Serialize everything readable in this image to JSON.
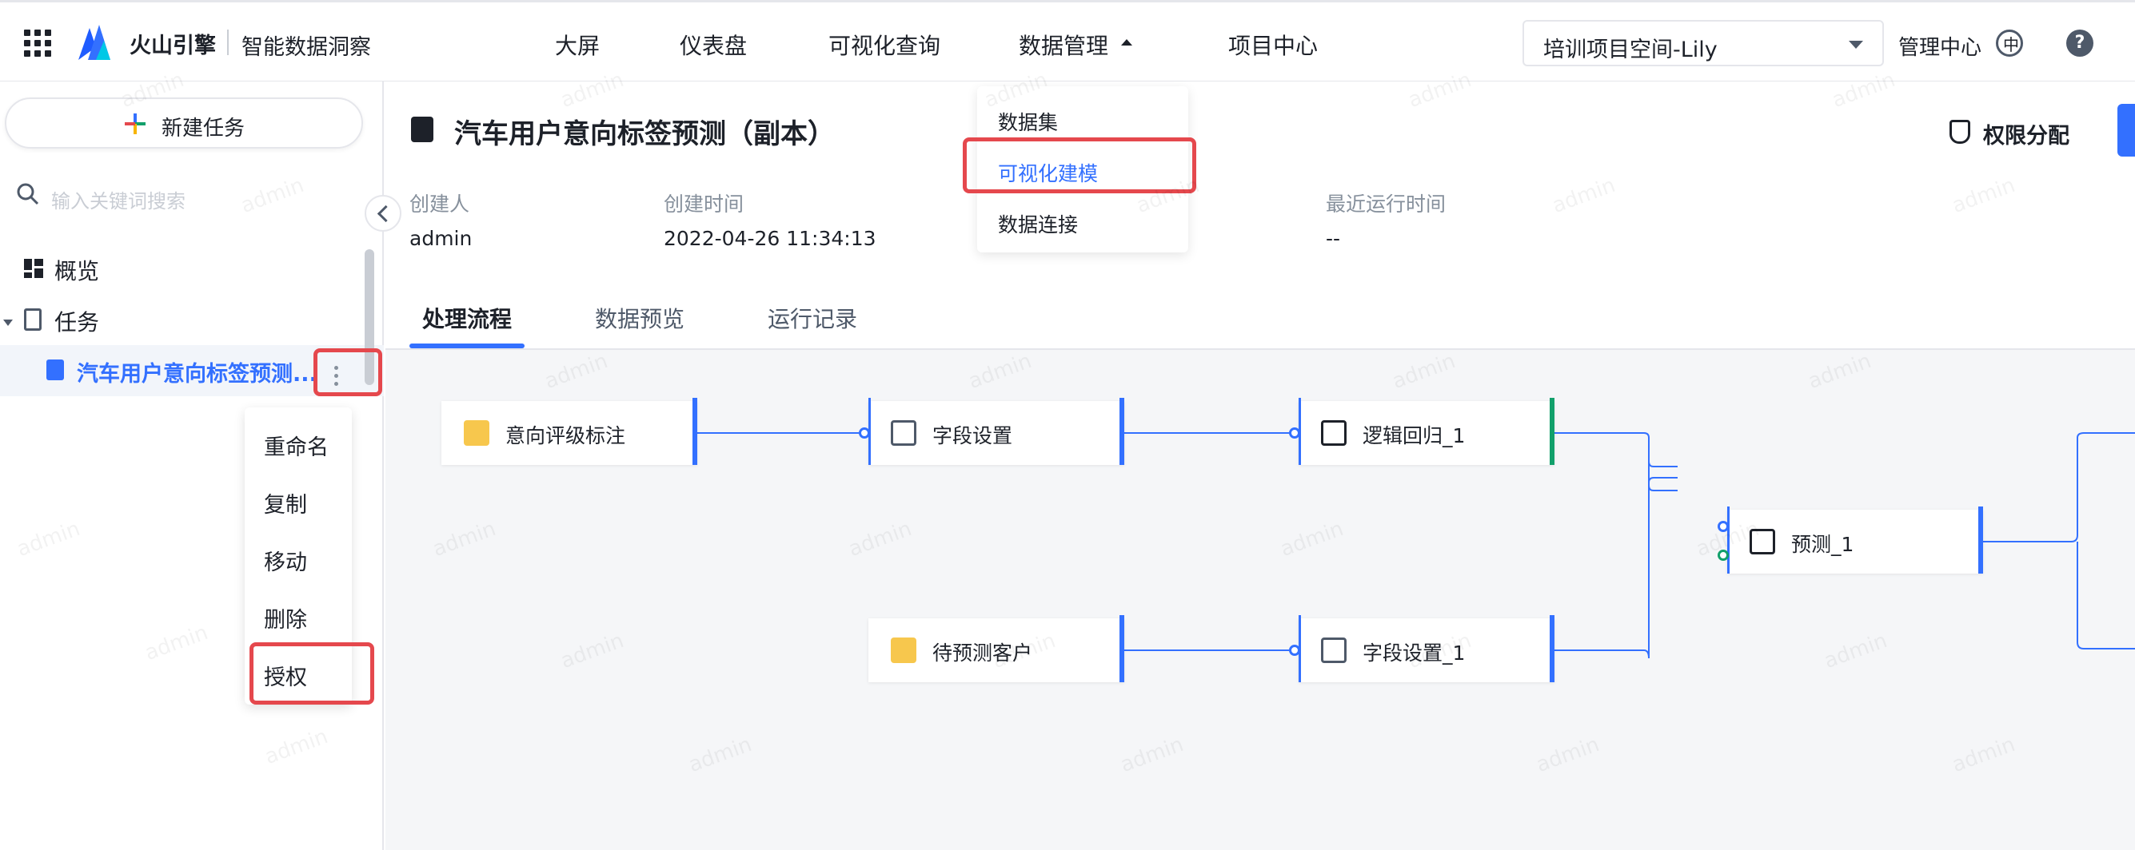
{
  "topbar": {
    "brand": "火山引擎",
    "product": "智能数据洞察",
    "nav": [
      {
        "label": "大屏"
      },
      {
        "label": "仪表盘"
      },
      {
        "label": "可视化查询"
      },
      {
        "label": "数据管理"
      },
      {
        "label": "项目中心"
      }
    ],
    "project_select": "培训项目空间-Lily",
    "admin_center": "管理中心"
  },
  "data_menu": {
    "items": [
      "数据集",
      "可视化建模",
      "数据连接"
    ],
    "highlighted": "可视化建模"
  },
  "sidebar": {
    "new_task": "新建任务",
    "search_placeholder": "输入关键词搜索",
    "items": [
      {
        "label": "概览"
      },
      {
        "label": "任务"
      }
    ],
    "active_task": "汽车用户意向标签预测..."
  },
  "context_menu": {
    "items": [
      "重命名",
      "复制",
      "移动",
      "删除",
      "授权"
    ]
  },
  "main": {
    "title": "汽车用户意向标签预测（副本）",
    "permission_button": "权限分配",
    "meta": [
      {
        "label": "创建人",
        "value": "admin"
      },
      {
        "label": "创建时间",
        "value": "2022-04-26 11:34:13"
      },
      {
        "label": "最近运行时间",
        "value": "--"
      }
    ],
    "tabs": [
      {
        "label": "处理流程"
      },
      {
        "label": "数据预览"
      },
      {
        "label": "运行记录"
      }
    ]
  },
  "flow": {
    "nodes": [
      {
        "label": "意向评级标注"
      },
      {
        "label": "字段设置"
      },
      {
        "label": "逻辑回归_1"
      },
      {
        "label": "预测_1"
      },
      {
        "label": "待预测客户"
      },
      {
        "label": "字段设置_1"
      }
    ]
  },
  "watermark": "admin",
  "colors": {
    "accent": "#3370ff",
    "highlight_box": "#e5484d",
    "success": "#12a06b"
  }
}
